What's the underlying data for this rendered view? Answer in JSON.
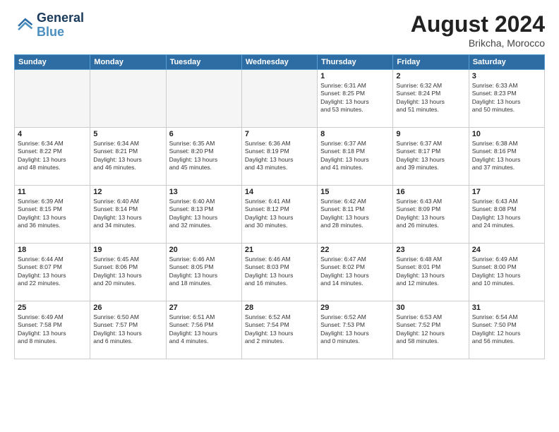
{
  "header": {
    "logo_line1": "General",
    "logo_line2": "Blue",
    "month_title": "August 2024",
    "location": "Brikcha, Morocco"
  },
  "weekdays": [
    "Sunday",
    "Monday",
    "Tuesday",
    "Wednesday",
    "Thursday",
    "Friday",
    "Saturday"
  ],
  "weeks": [
    [
      {
        "day": "",
        "empty": true
      },
      {
        "day": "",
        "empty": true
      },
      {
        "day": "",
        "empty": true
      },
      {
        "day": "",
        "empty": true
      },
      {
        "day": "1",
        "lines": [
          "Sunrise: 6:31 AM",
          "Sunset: 8:25 PM",
          "Daylight: 13 hours",
          "and 53 minutes."
        ]
      },
      {
        "day": "2",
        "lines": [
          "Sunrise: 6:32 AM",
          "Sunset: 8:24 PM",
          "Daylight: 13 hours",
          "and 51 minutes."
        ]
      },
      {
        "day": "3",
        "lines": [
          "Sunrise: 6:33 AM",
          "Sunset: 8:23 PM",
          "Daylight: 13 hours",
          "and 50 minutes."
        ]
      }
    ],
    [
      {
        "day": "4",
        "lines": [
          "Sunrise: 6:34 AM",
          "Sunset: 8:22 PM",
          "Daylight: 13 hours",
          "and 48 minutes."
        ]
      },
      {
        "day": "5",
        "lines": [
          "Sunrise: 6:34 AM",
          "Sunset: 8:21 PM",
          "Daylight: 13 hours",
          "and 46 minutes."
        ]
      },
      {
        "day": "6",
        "lines": [
          "Sunrise: 6:35 AM",
          "Sunset: 8:20 PM",
          "Daylight: 13 hours",
          "and 45 minutes."
        ]
      },
      {
        "day": "7",
        "lines": [
          "Sunrise: 6:36 AM",
          "Sunset: 8:19 PM",
          "Daylight: 13 hours",
          "and 43 minutes."
        ]
      },
      {
        "day": "8",
        "lines": [
          "Sunrise: 6:37 AM",
          "Sunset: 8:18 PM",
          "Daylight: 13 hours",
          "and 41 minutes."
        ]
      },
      {
        "day": "9",
        "lines": [
          "Sunrise: 6:37 AM",
          "Sunset: 8:17 PM",
          "Daylight: 13 hours",
          "and 39 minutes."
        ]
      },
      {
        "day": "10",
        "lines": [
          "Sunrise: 6:38 AM",
          "Sunset: 8:16 PM",
          "Daylight: 13 hours",
          "and 37 minutes."
        ]
      }
    ],
    [
      {
        "day": "11",
        "lines": [
          "Sunrise: 6:39 AM",
          "Sunset: 8:15 PM",
          "Daylight: 13 hours",
          "and 36 minutes."
        ]
      },
      {
        "day": "12",
        "lines": [
          "Sunrise: 6:40 AM",
          "Sunset: 8:14 PM",
          "Daylight: 13 hours",
          "and 34 minutes."
        ]
      },
      {
        "day": "13",
        "lines": [
          "Sunrise: 6:40 AM",
          "Sunset: 8:13 PM",
          "Daylight: 13 hours",
          "and 32 minutes."
        ]
      },
      {
        "day": "14",
        "lines": [
          "Sunrise: 6:41 AM",
          "Sunset: 8:12 PM",
          "Daylight: 13 hours",
          "and 30 minutes."
        ]
      },
      {
        "day": "15",
        "lines": [
          "Sunrise: 6:42 AM",
          "Sunset: 8:11 PM",
          "Daylight: 13 hours",
          "and 28 minutes."
        ]
      },
      {
        "day": "16",
        "lines": [
          "Sunrise: 6:43 AM",
          "Sunset: 8:09 PM",
          "Daylight: 13 hours",
          "and 26 minutes."
        ]
      },
      {
        "day": "17",
        "lines": [
          "Sunrise: 6:43 AM",
          "Sunset: 8:08 PM",
          "Daylight: 13 hours",
          "and 24 minutes."
        ]
      }
    ],
    [
      {
        "day": "18",
        "lines": [
          "Sunrise: 6:44 AM",
          "Sunset: 8:07 PM",
          "Daylight: 13 hours",
          "and 22 minutes."
        ]
      },
      {
        "day": "19",
        "lines": [
          "Sunrise: 6:45 AM",
          "Sunset: 8:06 PM",
          "Daylight: 13 hours",
          "and 20 minutes."
        ]
      },
      {
        "day": "20",
        "lines": [
          "Sunrise: 6:46 AM",
          "Sunset: 8:05 PM",
          "Daylight: 13 hours",
          "and 18 minutes."
        ]
      },
      {
        "day": "21",
        "lines": [
          "Sunrise: 6:46 AM",
          "Sunset: 8:03 PM",
          "Daylight: 13 hours",
          "and 16 minutes."
        ]
      },
      {
        "day": "22",
        "lines": [
          "Sunrise: 6:47 AM",
          "Sunset: 8:02 PM",
          "Daylight: 13 hours",
          "and 14 minutes."
        ]
      },
      {
        "day": "23",
        "lines": [
          "Sunrise: 6:48 AM",
          "Sunset: 8:01 PM",
          "Daylight: 13 hours",
          "and 12 minutes."
        ]
      },
      {
        "day": "24",
        "lines": [
          "Sunrise: 6:49 AM",
          "Sunset: 8:00 PM",
          "Daylight: 13 hours",
          "and 10 minutes."
        ]
      }
    ],
    [
      {
        "day": "25",
        "lines": [
          "Sunrise: 6:49 AM",
          "Sunset: 7:58 PM",
          "Daylight: 13 hours",
          "and 8 minutes."
        ]
      },
      {
        "day": "26",
        "lines": [
          "Sunrise: 6:50 AM",
          "Sunset: 7:57 PM",
          "Daylight: 13 hours",
          "and 6 minutes."
        ]
      },
      {
        "day": "27",
        "lines": [
          "Sunrise: 6:51 AM",
          "Sunset: 7:56 PM",
          "Daylight: 13 hours",
          "and 4 minutes."
        ]
      },
      {
        "day": "28",
        "lines": [
          "Sunrise: 6:52 AM",
          "Sunset: 7:54 PM",
          "Daylight: 13 hours",
          "and 2 minutes."
        ]
      },
      {
        "day": "29",
        "lines": [
          "Sunrise: 6:52 AM",
          "Sunset: 7:53 PM",
          "Daylight: 13 hours",
          "and 0 minutes."
        ]
      },
      {
        "day": "30",
        "lines": [
          "Sunrise: 6:53 AM",
          "Sunset: 7:52 PM",
          "Daylight: 12 hours",
          "and 58 minutes."
        ]
      },
      {
        "day": "31",
        "lines": [
          "Sunrise: 6:54 AM",
          "Sunset: 7:50 PM",
          "Daylight: 12 hours",
          "and 56 minutes."
        ]
      }
    ]
  ]
}
